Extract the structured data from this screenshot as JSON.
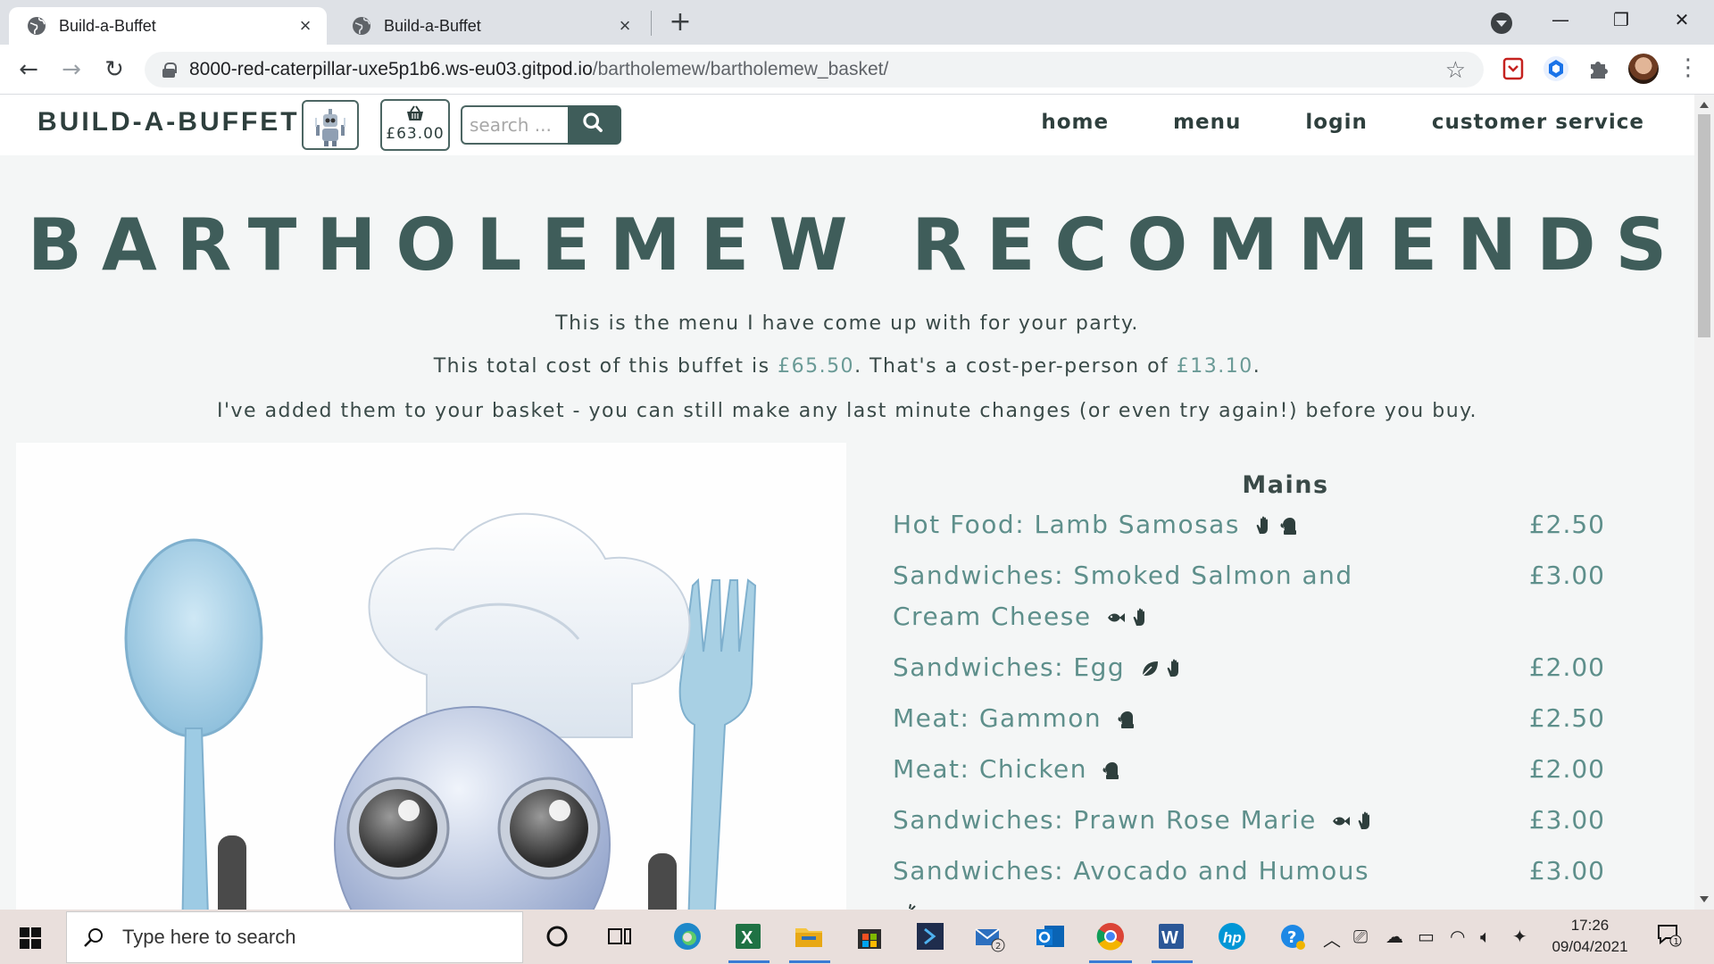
{
  "browser": {
    "tabs": [
      {
        "title": "Build-a-Buffet",
        "active": true
      },
      {
        "title": "Build-a-Buffet",
        "active": false
      }
    ],
    "url_host": "8000-red-caterpillar-uxe5p1b6.ws-eu03.gitpod.io",
    "url_path": "/bartholemew/bartholemew_basket/"
  },
  "site": {
    "brand": "BUILD-A-BUFFET",
    "basket_total": "£63.00",
    "search_placeholder": "search ...",
    "nav": [
      "home",
      "menu",
      "login",
      "customer service"
    ]
  },
  "page": {
    "title": "BARTHOLEMEW RECOMMENDS",
    "line1": "This is the menu I have come up with for your party.",
    "line2_a": "This total cost of this buffet is ",
    "total_cost": "£65.50",
    "line2_b": ". That's a cost-per-person of ",
    "per_person": "£13.10",
    "line2_c": ".",
    "line3": "I've added them to your basket - you can still make any last minute changes (or even try again!) before you buy."
  },
  "menu": {
    "heading": "Mains",
    "items": [
      {
        "name": "Hot Food: Lamb Samosas",
        "price": "£2.50",
        "icons": [
          "hand-icon",
          "mitten-icon"
        ]
      },
      {
        "name": "Sandwiches: Smoked Salmon and Cream Cheese",
        "price": "£3.00",
        "icons": [
          "fish-icon",
          "hand-icon"
        ]
      },
      {
        "name": "Sandwiches: Egg",
        "price": "£2.00",
        "icons": [
          "leaf-icon",
          "hand-icon"
        ]
      },
      {
        "name": "Meat: Gammon",
        "price": "£2.50",
        "icons": [
          "mitten-icon"
        ]
      },
      {
        "name": "Meat: Chicken",
        "price": "£2.00",
        "icons": [
          "mitten-icon"
        ]
      },
      {
        "name": "Sandwiches: Prawn Rose Marie",
        "price": "£3.00",
        "icons": [
          "fish-icon",
          "hand-icon"
        ]
      },
      {
        "name": "Sandwiches: Avocado and Humous",
        "price": "£3.00",
        "icons": [
          "carrot-icon"
        ]
      }
    ]
  },
  "taskbar": {
    "search_placeholder": "Type here to search",
    "time": "17:26",
    "date": "09/04/2021",
    "mail_badge": "2",
    "notification_count": "1"
  },
  "colors": {
    "accent": "#3f5d5a",
    "price_text": "#5e8f8b"
  }
}
